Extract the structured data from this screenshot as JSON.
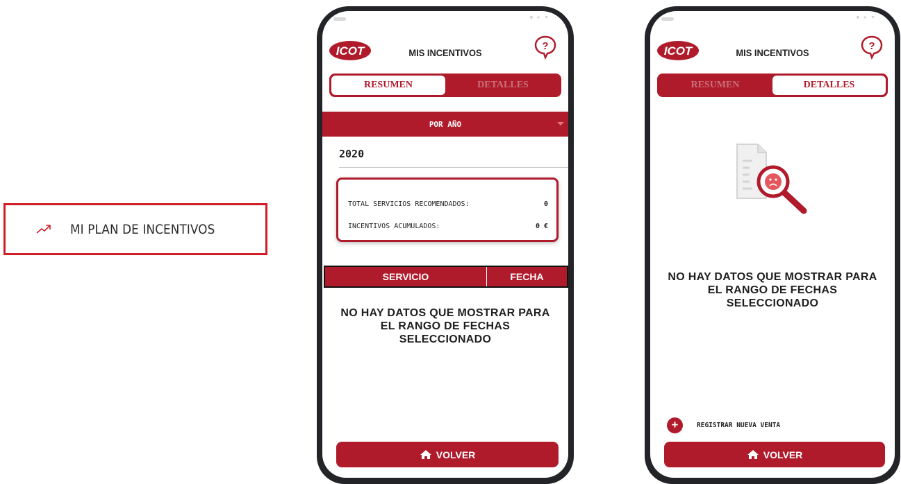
{
  "menu": {
    "label": "MI PLAN DE INCENTIVOS",
    "icon": "trending-up-icon"
  },
  "app": {
    "title": "MIS INCENTIVOS",
    "logo_text": "ICOT",
    "help_icon": "help-bubble-icon"
  },
  "tabs": {
    "resumen": "RESUMEN",
    "detalles": "DETALLES"
  },
  "resumen": {
    "period_label": "POR AÑO",
    "year": "2020",
    "summary": {
      "total_label": "TOTAL SERVICIOS RECOMENDADOS:",
      "total_value": "0",
      "incentives_label": "INCENTIVOS ACUMULADOS:",
      "incentives_value": "0 €"
    },
    "table_headers": {
      "servicio": "SERVICIO",
      "fecha": "FECHA"
    },
    "empty_message": "NO HAY DATOS QUE MOSTRAR PARA EL RANGO DE FECHAS SELECCIONADO"
  },
  "detalles": {
    "empty_message": "NO HAY DATOS QUE MOSTRAR PARA EL RANGO DE FECHAS SELECCIONADO",
    "register_label": "REGISTRAR NUEVA VENTA",
    "illustration_icon": "no-data-search-icon"
  },
  "footer": {
    "volver_label": "VOLVER",
    "icon": "home-icon"
  },
  "colors": {
    "brand": "#b01b2b",
    "menu_border": "#cf1e26"
  }
}
